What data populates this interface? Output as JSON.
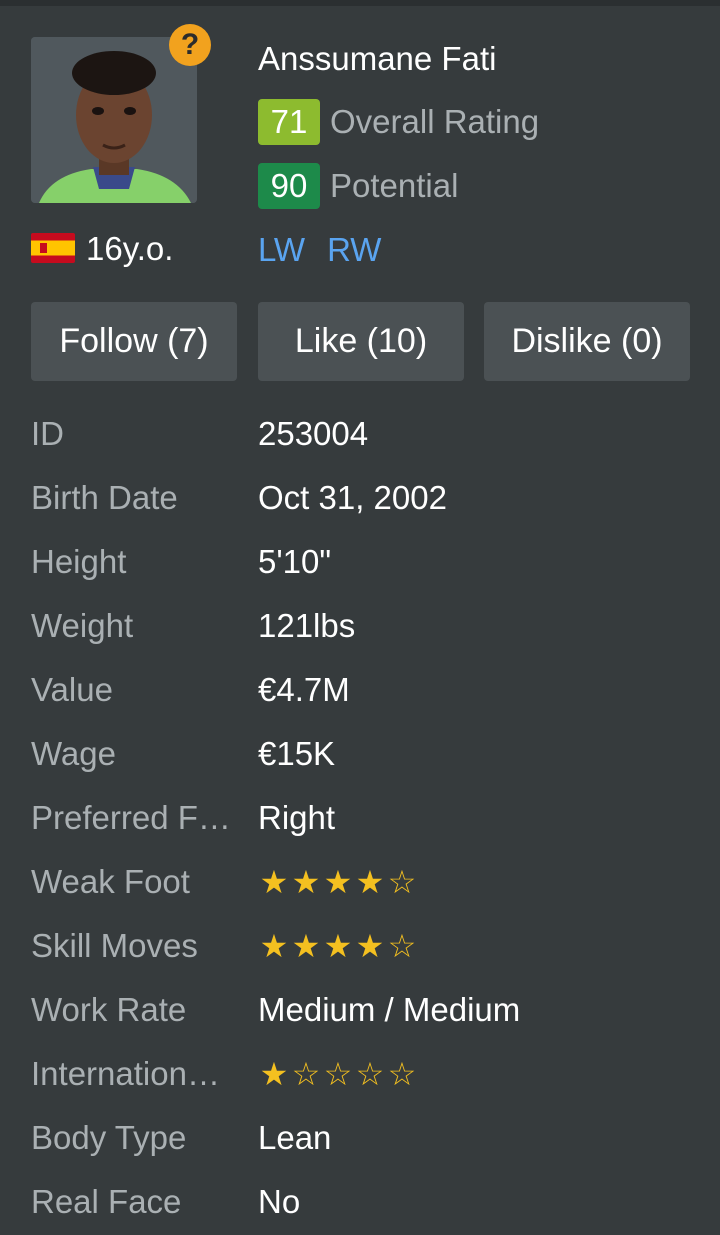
{
  "player": {
    "name": "Anssumane Fati",
    "age": "16y.o.",
    "nationality_flag": "spain-flag",
    "help_icon": "?",
    "overall": {
      "value": "71",
      "label": "Overall Rating",
      "color": "#8dbb2f"
    },
    "potential": {
      "value": "90",
      "label": "Potential",
      "color": "#1d8a4a"
    },
    "positions": [
      "LW",
      "RW"
    ]
  },
  "actions": {
    "follow": "Follow (7)",
    "like": "Like (10)",
    "dislike": "Dislike (0)"
  },
  "info": [
    {
      "label": "ID",
      "value": "253004"
    },
    {
      "label": "Birth Date",
      "value": "Oct 31, 2002"
    },
    {
      "label": "Height",
      "value": "5'10\""
    },
    {
      "label": "Weight",
      "value": "121lbs"
    },
    {
      "label": "Value",
      "value": "€4.7M"
    },
    {
      "label": "Wage",
      "value": "€15K"
    },
    {
      "label": "Preferred F…",
      "value": "Right"
    },
    {
      "label": "Weak Foot",
      "stars": 4
    },
    {
      "label": "Skill Moves",
      "stars": 4
    },
    {
      "label": "Work Rate",
      "value": "Medium / Medium"
    },
    {
      "label": "Internation…",
      "stars": 1
    },
    {
      "label": "Body Type",
      "value": "Lean"
    },
    {
      "label": "Real Face",
      "value": "No"
    }
  ],
  "colors": {
    "background": "#363b3d",
    "label": "#aab0b3",
    "link": "#5aa4f0",
    "star": "#f4c020",
    "button": "#4b5154"
  }
}
